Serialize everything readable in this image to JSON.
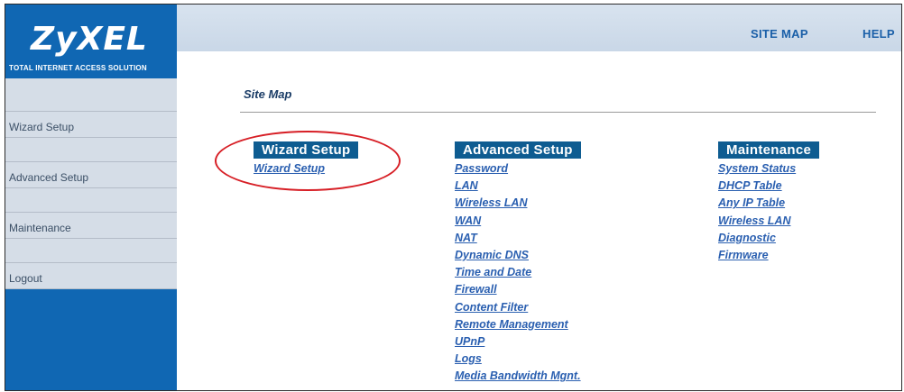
{
  "brand": {
    "logo": "ZyXEL",
    "tagline": "Total Internet Access Solution"
  },
  "header": {
    "site_map": "SITE MAP",
    "help": "HELP"
  },
  "sidebar": {
    "items": [
      {
        "label": "Wizard Setup"
      },
      {
        "label": "Advanced Setup"
      },
      {
        "label": "Maintenance"
      },
      {
        "label": "Logout"
      }
    ]
  },
  "main": {
    "title": "Site Map",
    "columns": [
      {
        "heading": "Wizard Setup",
        "links": [
          "Wizard Setup"
        ]
      },
      {
        "heading": "Advanced Setup",
        "links": [
          "Password",
          "LAN",
          "Wireless LAN",
          "WAN",
          "NAT",
          "Dynamic DNS",
          "Time and Date",
          "Firewall",
          "Content Filter",
          "Remote Management",
          "UPnP",
          "Logs",
          "Media Bandwidth Mgnt."
        ]
      },
      {
        "heading": "Maintenance",
        "links": [
          "System Status",
          "DHCP Table",
          "Any IP Table",
          "Wireless LAN",
          "Diagnostic",
          "Firmware"
        ]
      }
    ]
  },
  "colors": {
    "sidebar_blue": "#1067b3",
    "heading_blue": "#0e5c91",
    "link_blue": "#2a5fb0",
    "callout_red": "#d71f26"
  }
}
